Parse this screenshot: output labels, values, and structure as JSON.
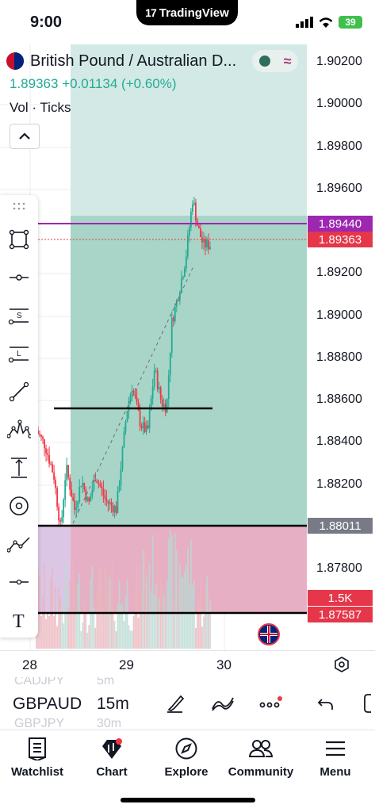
{
  "status_bar": {
    "time": "9:00",
    "app_badge": "TradingView",
    "battery": "39"
  },
  "symbol": {
    "name": "British Pound / Australian D...",
    "price": "1.89363",
    "change": "+0.01134",
    "change_pct": "(+0.60%)",
    "indicator": "Vol · Ticks"
  },
  "price_scale": {
    "ticks": [
      "1.90200",
      "1.90000",
      "1.89800",
      "1.89600",
      "1.89200",
      "1.89000",
      "1.88800",
      "1.88600",
      "1.88400",
      "1.88200",
      "1.87800"
    ],
    "tags": {
      "target": "1.89440",
      "current": "1.89363",
      "entry": "1.88011",
      "volume": "1.5K",
      "stop": "1.87587"
    }
  },
  "time_axis": {
    "labels": [
      "28",
      "29",
      "30"
    ]
  },
  "symbol_bar": {
    "prev_symbol": "CADJPY",
    "prev_interval": "5m",
    "symbol": "GBPAUD",
    "interval": "15m",
    "next_symbol": "GBPJPY",
    "next_interval": "30m"
  },
  "bottom_nav": {
    "items": [
      {
        "label": "Watchlist",
        "icon": "watchlist-icon"
      },
      {
        "label": "Chart",
        "icon": "chart-icon"
      },
      {
        "label": "Explore",
        "icon": "compass-icon"
      },
      {
        "label": "Community",
        "icon": "community-icon"
      },
      {
        "label": "Menu",
        "icon": "menu-icon"
      }
    ]
  },
  "colors": {
    "profit_zone": "#cfe6e2",
    "profit_zone_strong": "#a5d6c9",
    "loss_zone": "#e9aec4",
    "up_candle": "#22ab94",
    "down_candle": "#f23645",
    "target_line": "#9c27b0",
    "accent_red": "#e5364a"
  },
  "chart_data": {
    "type": "candlestick",
    "x_labels": [
      "28",
      "29",
      "30"
    ],
    "ylim": [
      1.8746,
      1.903
    ],
    "levels": {
      "target": 1.8944,
      "current": 1.89363,
      "entry": 1.88011,
      "stop": 1.87587,
      "horizontal_line": 1.88567
    },
    "approx_path": [
      [
        0.0,
        1.8849
      ],
      [
        0.05,
        1.8842
      ],
      [
        0.1,
        1.8828
      ],
      [
        0.14,
        1.8802
      ],
      [
        0.17,
        1.8832
      ],
      [
        0.22,
        1.8812
      ],
      [
        0.26,
        1.8826
      ],
      [
        0.3,
        1.8814
      ],
      [
        0.34,
        1.8828
      ],
      [
        0.4,
        1.8816
      ],
      [
        0.46,
        1.8812
      ],
      [
        0.52,
        1.8858
      ],
      [
        0.55,
        1.887
      ],
      [
        0.6,
        1.8852
      ],
      [
        0.64,
        1.8848
      ],
      [
        0.68,
        1.8878
      ],
      [
        0.72,
        1.8862
      ],
      [
        0.75,
        1.886
      ],
      [
        0.78,
        1.89
      ],
      [
        0.82,
        1.8914
      ],
      [
        0.86,
        1.893
      ],
      [
        0.9,
        1.8958
      ],
      [
        0.93,
        1.8944
      ],
      [
        0.96,
        1.8936
      ]
    ]
  }
}
